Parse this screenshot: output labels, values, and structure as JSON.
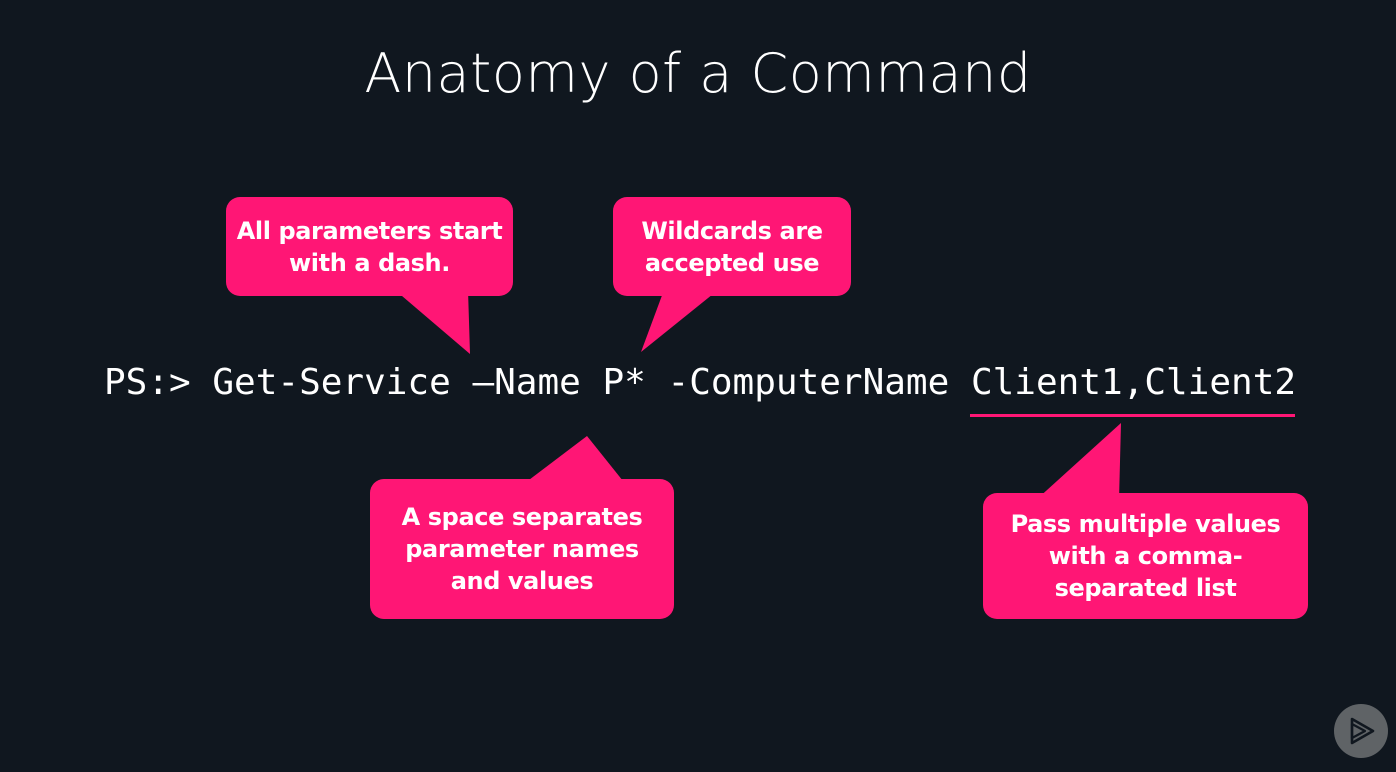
{
  "title": "Anatomy of a Command",
  "command": "PS:> Get-Service —Name P* -ComputerName Client1,Client2",
  "accent_color": "#ff1675",
  "background_color": "#10171f",
  "callouts": [
    {
      "lines": [
        "All parameters start",
        "with a dash."
      ]
    },
    {
      "lines": [
        "Wildcards are",
        "accepted use"
      ]
    },
    {
      "lines": [
        "A space separates",
        "parameter names",
        "and values"
      ]
    },
    {
      "lines": [
        "Pass multiple values",
        "with a comma-",
        "separated list"
      ]
    }
  ],
  "logo_icon": "play-triangle-icon"
}
